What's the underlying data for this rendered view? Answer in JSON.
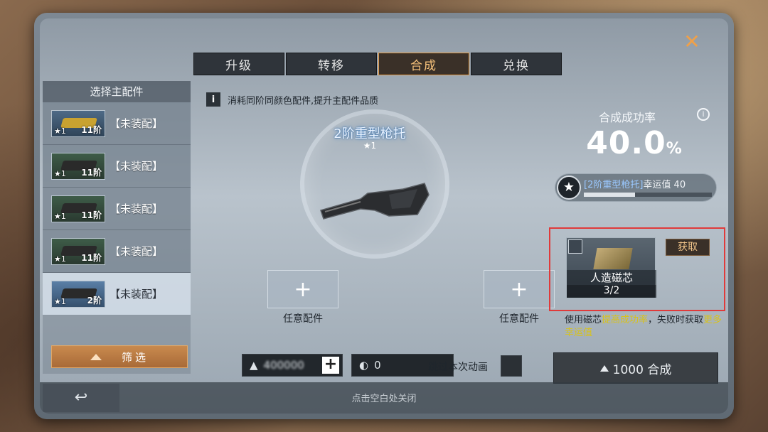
{
  "tabs": [
    {
      "label": "升级",
      "active": false
    },
    {
      "label": "转移",
      "active": false
    },
    {
      "label": "合成",
      "active": true
    },
    {
      "label": "兑换",
      "active": false
    }
  ],
  "left_panel": {
    "title": "选择主配件",
    "items": [
      {
        "star": "★1",
        "level": "11阶",
        "status": "【未装配】",
        "thumb": "gold"
      },
      {
        "star": "★1",
        "level": "11阶",
        "status": "【未装配】",
        "thumb": "green"
      },
      {
        "star": "★1",
        "level": "11阶",
        "status": "【未装配】",
        "thumb": "green"
      },
      {
        "star": "★1",
        "level": "11阶",
        "status": "【未装配】",
        "thumb": "green"
      },
      {
        "star": "★1",
        "level": "2阶",
        "status": "【未装配】",
        "thumb": "blue",
        "selected": true
      }
    ],
    "filter_label": "筛选"
  },
  "center": {
    "info_text": "消耗同阶同颜色配件,提升主配件品质",
    "part_name": "2阶重型枪托",
    "part_star": "★1",
    "slot_left_label": "任意配件",
    "slot_right_label": "任意配件",
    "currency_value": "400000",
    "ticket_value": "0",
    "skip_label": "跳过本次动画"
  },
  "right_panel": {
    "rate_title": "合成成功率",
    "rate_value": "40.0",
    "rate_unit": "%",
    "luck_item": "[2阶重型枪托]",
    "luck_text": "幸运值 40",
    "luck_progress": 0.4,
    "core_name": "人造磁芯",
    "core_count": "3/2",
    "get_label": "获取",
    "tip_prefix": "使用磁芯",
    "tip_hl1": "提高成功率",
    "tip_mid": "，失败时获取",
    "tip_hl2": "更多幸运值",
    "compose_label": "1000 合成"
  },
  "footer": {
    "hint": "点击空白处关闭"
  }
}
